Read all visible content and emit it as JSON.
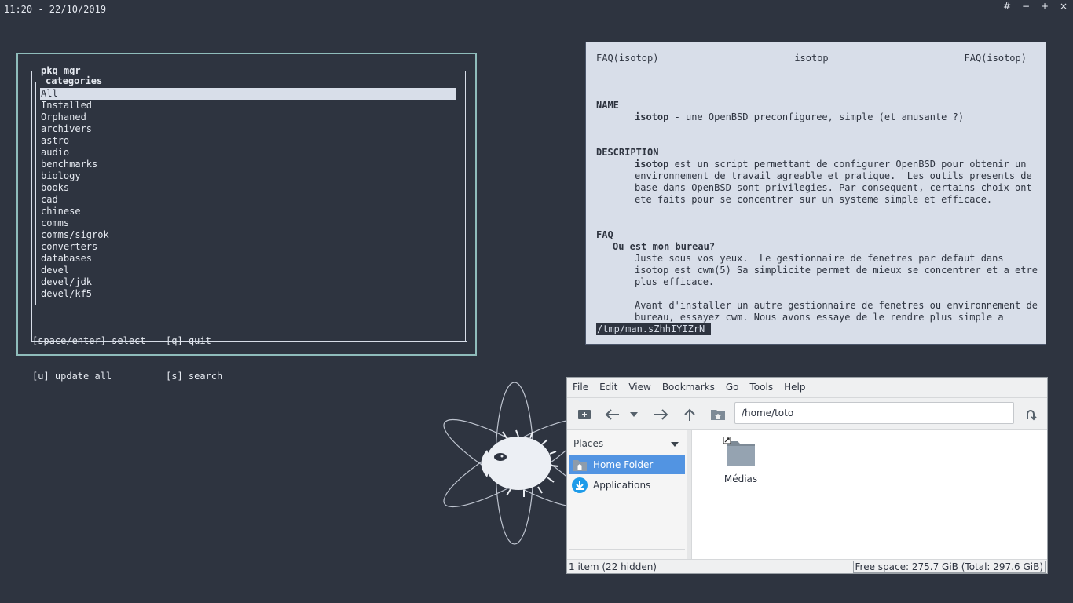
{
  "topbar": {
    "clock": "11:20 - 22/10/2019",
    "controls": [
      "#",
      "−",
      "+",
      "×"
    ]
  },
  "pkg_mgr": {
    "title": "pkg_mgr",
    "categories_title": "categories",
    "categories": [
      "All",
      "Installed",
      "Orphaned",
      "archivers",
      "astro",
      "audio",
      "benchmarks",
      "biology",
      "books",
      "cad",
      "chinese",
      "comms",
      "comms/sigrok",
      "converters",
      "databases",
      "devel",
      "devel/jdk",
      "devel/kf5"
    ],
    "selected_index": 0,
    "help": [
      [
        "[space/enter] select",
        "[q] quit"
      ],
      [
        "[u] update all",
        "[s] search"
      ]
    ]
  },
  "man": {
    "header_left": "FAQ(isotop)",
    "header_center": "isotop",
    "header_right": "FAQ(isotop)",
    "name_heading": "NAME",
    "name_bold": "isotop",
    "name_text": " - une OpenBSD preconfiguree, simple (et amusante ?)",
    "desc_heading": "DESCRIPTION",
    "desc_bold": "isotop",
    "desc_line1": " est un script permettant de configurer OpenBSD pour obtenir un",
    "desc_line2": "environnement de travail agreable et pratique.  Les outils presents de",
    "desc_line3": "base dans OpenBSD sont privilegies. Par consequent, certains choix ont",
    "desc_line4": "ete faits pour se concentrer sur un systeme simple et efficace.",
    "faq_heading": "FAQ",
    "faq_sub": "Ou est mon bureau?",
    "faq_line1": "Juste sous vos yeux.  Le gestionnaire de fenetres par defaut dans",
    "faq_line2": "isotop est cwm(5) Sa simplicite permet de mieux se concentrer et a etre",
    "faq_line3": "plus efficace.",
    "faq_line4": "Avant d'installer un autre gestionnaire de fenetres ou environnement de",
    "faq_line5": "bureau, essayez cwm. Nous avons essaye de le rendre plus simple a",
    "prompt": "/tmp/man.sZhhIYIZrN"
  },
  "filemanager": {
    "menu": [
      "File",
      "Edit",
      "View",
      "Bookmarks",
      "Go",
      "Tools",
      "Help"
    ],
    "path": "/home/toto",
    "places_label": "Places",
    "places": [
      {
        "label": "Home Folder",
        "icon": "home-folder-icon",
        "active": true
      },
      {
        "label": "Applications",
        "icon": "applications-icon",
        "active": false
      }
    ],
    "file_name": "Médias",
    "status_left": "1 item (22 hidden)",
    "status_right": "Free space: 275.7 GiB (Total: 297.6 GiB)",
    "accent": "#5294e2"
  },
  "colors": {
    "desktop": "#2e3440",
    "terminal_border": "#8fbcbb",
    "man_background": "#d8dee9"
  }
}
